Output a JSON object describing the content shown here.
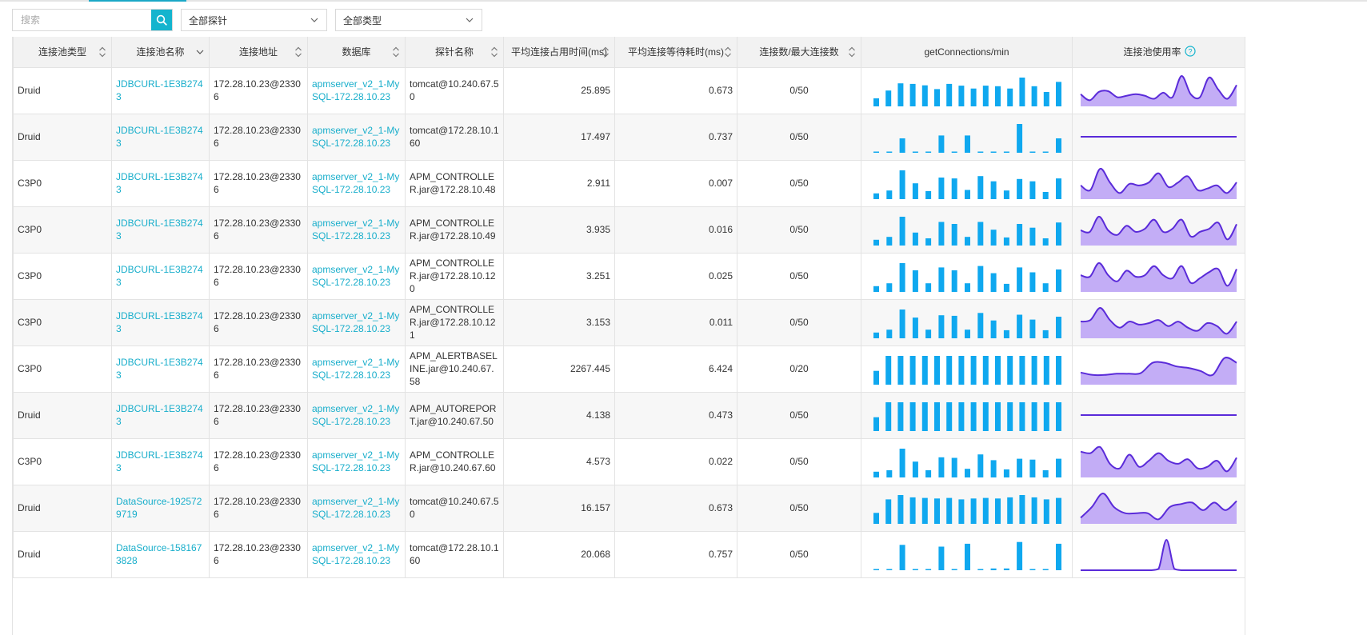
{
  "toolbar": {
    "search_placeholder": "搜索",
    "probe_select": "全部探针",
    "type_select": "全部类型"
  },
  "columns": [
    {
      "key": "type",
      "label": "连接池类型",
      "sort": "updown"
    },
    {
      "key": "name",
      "label": "连接池名称",
      "sort": "down"
    },
    {
      "key": "addr",
      "label": "连接地址",
      "sort": "updown"
    },
    {
      "key": "db",
      "label": "数据库",
      "sort": "updown"
    },
    {
      "key": "probe",
      "label": "探针名称",
      "sort": "updown"
    },
    {
      "key": "occupy",
      "label": "平均连接占用时间(ms)",
      "sort": "updown"
    },
    {
      "key": "wait",
      "label": "平均连接等待耗时(ms)",
      "sort": "updown"
    },
    {
      "key": "conn",
      "label": "连接数/最大连接数",
      "sort": "updown"
    },
    {
      "key": "getconn",
      "label": "getConnections/min",
      "sort": ""
    },
    {
      "key": "usage",
      "label": "连接池使用率",
      "sort": ""
    }
  ],
  "colors": {
    "accent": "#14b4ce",
    "link": "#18aecb",
    "bar": "#0fa8ef",
    "area_fill": "#c3adf6",
    "area_line": "#5a2bd9"
  },
  "rows": [
    {
      "type": "Druid",
      "name": "JDBCURL-1E3B2743",
      "addr": "172.28.10.23@23306",
      "db": "apmserver_v2_1-MySQL-172.28.10.23",
      "probe": "tomcat@10.240.67.50",
      "occupy": "25.895",
      "wait": "0.673",
      "conn": "0/50",
      "bars": [
        0.28,
        0.55,
        0.8,
        0.78,
        0.73,
        0.6,
        0.78,
        0.72,
        0.62,
        0.72,
        0.7,
        0.62,
        1.0,
        0.7,
        0.5,
        0.85
      ],
      "usage": [
        0.4,
        0.2,
        0.48,
        0.5,
        0.3,
        0.35,
        0.4,
        0.35,
        0.25,
        0.45,
        0.3,
        1.0,
        0.4,
        0.3,
        0.95,
        0.55,
        0.25,
        0.7
      ]
    },
    {
      "type": "Druid",
      "name": "JDBCURL-1E3B2743",
      "addr": "172.28.10.23@23306",
      "db": "apmserver_v2_1-MySQL-172.28.10.23",
      "probe": "tomcat@172.28.10.160",
      "occupy": "17.497",
      "wait": "0.737",
      "conn": "0/50",
      "bars": [
        0.03,
        0.03,
        0.5,
        0.03,
        0.03,
        0.6,
        0.03,
        0.6,
        0.03,
        0.03,
        0.03,
        1.0,
        0.03,
        0.03,
        0.5
      ],
      "usage": [
        0.5,
        0.5,
        0.5,
        0.5,
        0.5,
        0.5,
        0.5,
        0.5,
        0.5,
        0.5,
        0.5,
        0.5
      ]
    },
    {
      "type": "C3P0",
      "name": "JDBCURL-1E3B2743",
      "addr": "172.28.10.23@23306",
      "db": "apmserver_v2_1-MySQL-172.28.10.23",
      "probe": "APM_CONTROLLER.jar@172.28.10.48",
      "occupy": "2.911",
      "wait": "0.007",
      "conn": "0/50",
      "bars": [
        0.2,
        0.3,
        1.0,
        0.55,
        0.28,
        0.75,
        0.72,
        0.32,
        0.8,
        0.62,
        0.3,
        0.7,
        0.62,
        0.25,
        0.72
      ],
      "usage": [
        0.45,
        0.3,
        1.0,
        0.55,
        0.2,
        0.5,
        0.45,
        0.55,
        0.85,
        0.4,
        0.55,
        0.75,
        0.3,
        0.35,
        0.45,
        0.2,
        0.55
      ]
    },
    {
      "type": "C3P0",
      "name": "JDBCURL-1E3B2743",
      "addr": "172.28.10.23@23306",
      "db": "apmserver_v2_1-MySQL-172.28.10.23",
      "probe": "APM_CONTROLLER.jar@172.28.10.49",
      "occupy": "3.935",
      "wait": "0.016",
      "conn": "0/50",
      "bars": [
        0.2,
        0.3,
        1.0,
        0.45,
        0.25,
        0.82,
        0.75,
        0.3,
        0.82,
        0.55,
        0.28,
        0.75,
        0.62,
        0.25,
        0.8
      ],
      "usage": [
        0.5,
        0.45,
        0.95,
        0.5,
        0.35,
        0.65,
        0.45,
        0.55,
        0.85,
        0.45,
        0.55,
        0.85,
        0.3,
        0.45,
        0.55,
        0.75,
        0.2,
        0.7
      ]
    },
    {
      "type": "C3P0",
      "name": "JDBCURL-1E3B2743",
      "addr": "172.28.10.23@23306",
      "db": "apmserver_v2_1-MySQL-172.28.10.23",
      "probe": "APM_CONTROLLER.jar@172.28.10.120",
      "occupy": "3.251",
      "wait": "0.025",
      "conn": "0/50",
      "bars": [
        0.2,
        0.3,
        1.0,
        0.75,
        0.3,
        0.85,
        0.75,
        0.3,
        0.9,
        0.65,
        0.28,
        0.85,
        0.68,
        0.3,
        0.78
      ],
      "usage": [
        0.55,
        0.5,
        0.95,
        0.55,
        0.35,
        0.7,
        0.5,
        0.55,
        0.85,
        0.55,
        0.45,
        0.85,
        0.3,
        0.45,
        0.65,
        0.75,
        0.2,
        0.75
      ]
    },
    {
      "type": "C3P0",
      "name": "JDBCURL-1E3B2743",
      "addr": "172.28.10.23@23306",
      "db": "apmserver_v2_1-MySQL-172.28.10.23",
      "probe": "APM_CONTROLLER.jar@172.28.10.121",
      "occupy": "3.153",
      "wait": "0.011",
      "conn": "0/50",
      "bars": [
        0.2,
        0.3,
        1.0,
        0.72,
        0.3,
        0.8,
        0.78,
        0.3,
        0.88,
        0.62,
        0.28,
        0.82,
        0.65,
        0.28,
        0.75
      ],
      "usage": [
        0.55,
        0.6,
        1.0,
        0.6,
        0.35,
        0.55,
        0.45,
        0.5,
        0.6,
        0.4,
        0.55,
        0.35,
        0.25,
        0.5,
        0.4,
        0.15,
        0.55
      ]
    },
    {
      "type": "C3P0",
      "name": "JDBCURL-1E3B2743",
      "addr": "172.28.10.23@23306",
      "db": "apmserver_v2_1-MySQL-172.28.10.23",
      "probe": "APM_ALERTBASELINE.jar@10.240.67.58",
      "occupy": "2267.445",
      "wait": "6.424",
      "conn": "0/20",
      "bars": [
        0.48,
        1.0,
        1.0,
        1.0,
        1.0,
        1.0,
        1.0,
        1.0,
        1.0,
        1.0,
        1.0,
        1.0,
        1.0,
        1.0,
        1.0,
        1.0
      ],
      "usage": [
        0.4,
        0.32,
        0.32,
        0.36,
        0.36,
        0.38,
        0.72,
        0.72,
        0.6,
        0.55,
        0.45,
        0.32,
        0.88,
        0.72
      ]
    },
    {
      "type": "Druid",
      "name": "JDBCURL-1E3B2743",
      "addr": "172.28.10.23@23306",
      "db": "apmserver_v2_1-MySQL-172.28.10.23",
      "probe": "APM_AUTOREPORT.jar@10.240.67.50",
      "occupy": "4.138",
      "wait": "0.473",
      "conn": "0/50",
      "bars": [
        0.48,
        1.0,
        1.0,
        1.0,
        1.0,
        1.0,
        1.0,
        1.0,
        1.0,
        1.0,
        1.0,
        1.0,
        1.0,
        1.0,
        1.0,
        1.0
      ],
      "usage": [
        0.5,
        0.5,
        0.5,
        0.5,
        0.5,
        0.5,
        0.5,
        0.5,
        0.5,
        0.5,
        0.5,
        0.5
      ]
    },
    {
      "type": "C3P0",
      "name": "JDBCURL-1E3B2743",
      "addr": "172.28.10.23@23306",
      "db": "apmserver_v2_1-MySQL-172.28.10.23",
      "probe": "APM_CONTROLLER.jar@10.240.67.60",
      "occupy": "4.573",
      "wait": "0.022",
      "conn": "0/50",
      "bars": [
        0.2,
        0.25,
        1.0,
        0.55,
        0.25,
        0.7,
        0.68,
        0.3,
        0.8,
        0.6,
        0.28,
        0.65,
        0.62,
        0.25,
        0.65
      ],
      "usage": [
        0.85,
        0.8,
        1.0,
        0.45,
        0.3,
        0.75,
        0.35,
        0.55,
        0.8,
        0.55,
        0.45,
        0.6,
        0.3,
        0.35,
        0.55,
        0.2,
        0.65
      ]
    },
    {
      "type": "Druid",
      "name": "DataSource-1925729719",
      "addr": "172.28.10.23@23306",
      "db": "apmserver_v2_1-MySQL-172.28.10.23",
      "probe": "tomcat@10.240.67.50",
      "occupy": "16.157",
      "wait": "0.673",
      "conn": "0/50",
      "bars": [
        0.38,
        0.85,
        1.0,
        0.92,
        0.9,
        0.88,
        0.9,
        0.85,
        0.88,
        0.9,
        0.88,
        0.92,
        1.0,
        0.92,
        0.85,
        0.9
      ],
      "usage": [
        0.2,
        0.55,
        1.0,
        0.55,
        0.35,
        0.35,
        0.35,
        0.15,
        0.55,
        0.65,
        0.7,
        0.45,
        0.7,
        0.45,
        0.75
      ]
    },
    {
      "type": "Druid",
      "name": "DataSource-1581673828",
      "addr": "172.28.10.23@23306",
      "db": "apmserver_v2_1-MySQL-172.28.10.23",
      "probe": "tomcat@172.28.10.160",
      "occupy": "20.068",
      "wait": "0.757",
      "conn": "0/50",
      "bars": [
        0.03,
        0.03,
        0.88,
        0.03,
        0.03,
        0.82,
        0.03,
        0.92,
        0.03,
        0.06,
        0.06,
        0.98,
        0.03,
        0.03,
        0.92
      ],
      "usage": [
        0,
        0,
        0,
        0,
        0,
        0,
        0,
        0,
        0,
        0,
        0.05,
        1.0,
        0.05,
        0,
        0,
        0,
        0,
        0,
        0,
        0,
        0
      ]
    }
  ]
}
